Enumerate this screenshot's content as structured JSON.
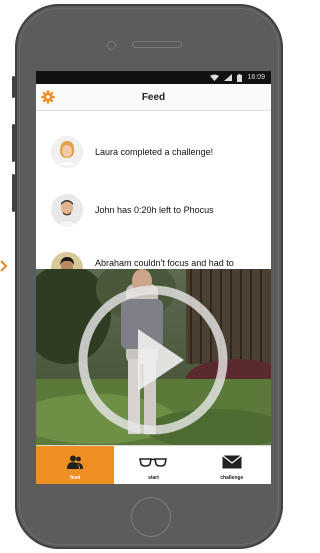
{
  "status_bar": {
    "time": "16:09"
  },
  "nav": {
    "title": "Feed"
  },
  "feed": [
    {
      "text": "Laura completed a challenge!"
    },
    {
      "text": "John has 0:20h left to Phocus"
    },
    {
      "text": "Abraham couldn't focus and had to try his best British accent:"
    }
  ],
  "tabs": [
    {
      "label": "feed",
      "icon": "people-icon",
      "active": true
    },
    {
      "label": "start",
      "icon": "glasses-icon",
      "active": false
    },
    {
      "label": "challenge",
      "icon": "envelope-icon",
      "active": false
    }
  ],
  "colors": {
    "accent": "#f08f24",
    "phone": "#5a5c5e"
  }
}
